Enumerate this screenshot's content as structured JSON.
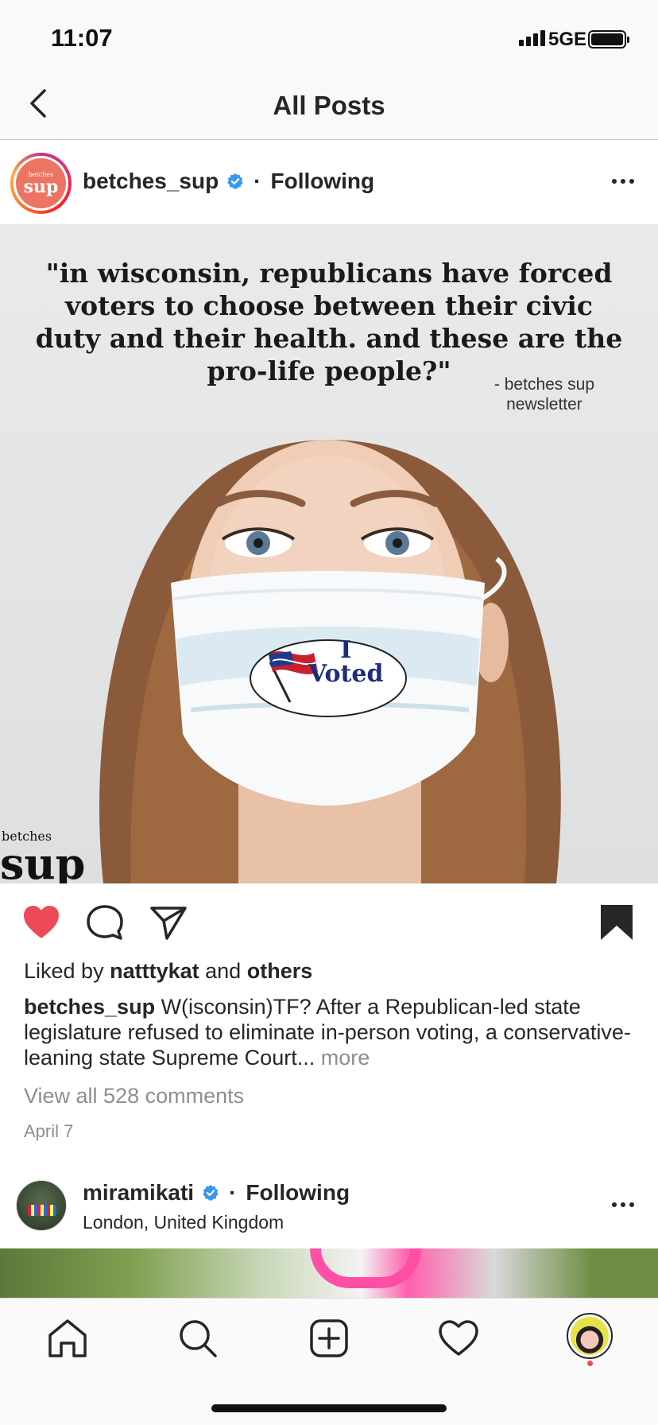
{
  "status_bar": {
    "time": "11:07",
    "network": "5GE"
  },
  "nav": {
    "title": "All Posts"
  },
  "post": {
    "username": "betches_sup",
    "separator": "·",
    "follow_status": "Following",
    "avatar_text_small": "betches",
    "avatar_text_big": "sup",
    "image": {
      "quote": "\"in wisconsin, republicans have forced voters to choose between their civic duty and their health. and these are the pro-life people?\"",
      "attribution_line1": "- betches sup",
      "attribution_line2": "newsletter",
      "sticker_line1": "I",
      "sticker_line2": "Voted",
      "watermark_small": "betches",
      "watermark_big": "sup"
    },
    "liked_prefix": "Liked by",
    "liked_user": "natttykat",
    "liked_and": "and",
    "liked_others": "others",
    "caption_user": "betches_sup",
    "caption_text": "W(isconsin)TF? After a Republican-led state legislature refused to eliminate in-person voting, a conservative-leaning state Supreme Court...",
    "caption_more": "more",
    "view_comments": "View all 528 comments",
    "date": "April 7",
    "liked": true,
    "saved": true
  },
  "next_post": {
    "username": "miramikati",
    "separator": "·",
    "follow_status": "Following",
    "location": "London, United Kingdom"
  },
  "colors": {
    "like_red": "#ed4956",
    "verified_blue": "#3897f0",
    "muted_text": "#8e8e8e",
    "text": "#262626"
  },
  "icons": {
    "back": "chevron-left-icon",
    "like": "heart-filled-icon",
    "comment": "comment-bubble-icon",
    "share": "paper-plane-icon",
    "save": "bookmark-filled-icon",
    "home": "home-icon",
    "search": "search-icon",
    "new_post": "plus-square-icon",
    "activity": "heart-outline-icon",
    "profile": "profile-avatar-icon"
  }
}
